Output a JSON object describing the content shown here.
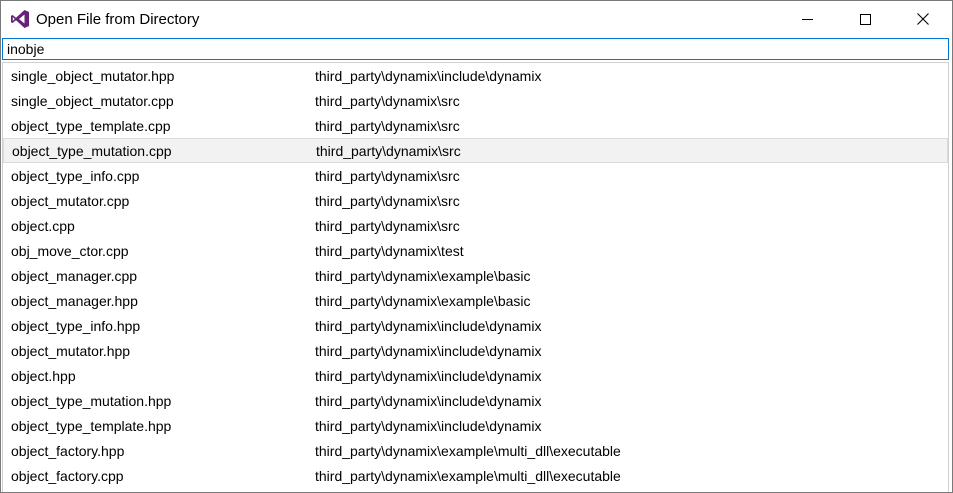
{
  "window": {
    "title": "Open File from Directory",
    "colors": {
      "accent": "#0078d7",
      "selected_row": "#f2f2f2",
      "logo": "#68217a"
    },
    "icons": {
      "app": "visual-studio-icon",
      "minimize": "minimize-icon",
      "maximize": "maximize-icon",
      "close": "close-icon"
    }
  },
  "search": {
    "value": "inobje"
  },
  "files": [
    {
      "name": "single_object_mutator.hpp",
      "path": "third_party\\dynamix\\include\\dynamix"
    },
    {
      "name": "single_object_mutator.cpp",
      "path": "third_party\\dynamix\\src"
    },
    {
      "name": "object_type_template.cpp",
      "path": "third_party\\dynamix\\src"
    },
    {
      "name": "object_type_mutation.cpp",
      "path": "third_party\\dynamix\\src",
      "selected": true
    },
    {
      "name": "object_type_info.cpp",
      "path": "third_party\\dynamix\\src"
    },
    {
      "name": "object_mutator.cpp",
      "path": "third_party\\dynamix\\src"
    },
    {
      "name": "object.cpp",
      "path": "third_party\\dynamix\\src"
    },
    {
      "name": "obj_move_ctor.cpp",
      "path": "third_party\\dynamix\\test"
    },
    {
      "name": "object_manager.cpp",
      "path": "third_party\\dynamix\\example\\basic"
    },
    {
      "name": "object_manager.hpp",
      "path": "third_party\\dynamix\\example\\basic"
    },
    {
      "name": "object_type_info.hpp",
      "path": "third_party\\dynamix\\include\\dynamix"
    },
    {
      "name": "object_mutator.hpp",
      "path": "third_party\\dynamix\\include\\dynamix"
    },
    {
      "name": "object.hpp",
      "path": "third_party\\dynamix\\include\\dynamix"
    },
    {
      "name": "object_type_mutation.hpp",
      "path": "third_party\\dynamix\\include\\dynamix"
    },
    {
      "name": "object_type_template.hpp",
      "path": "third_party\\dynamix\\include\\dynamix"
    },
    {
      "name": "object_factory.hpp",
      "path": "third_party\\dynamix\\example\\multi_dll\\executable"
    },
    {
      "name": "object_factory.cpp",
      "path": "third_party\\dynamix\\example\\multi_dll\\executable"
    }
  ]
}
